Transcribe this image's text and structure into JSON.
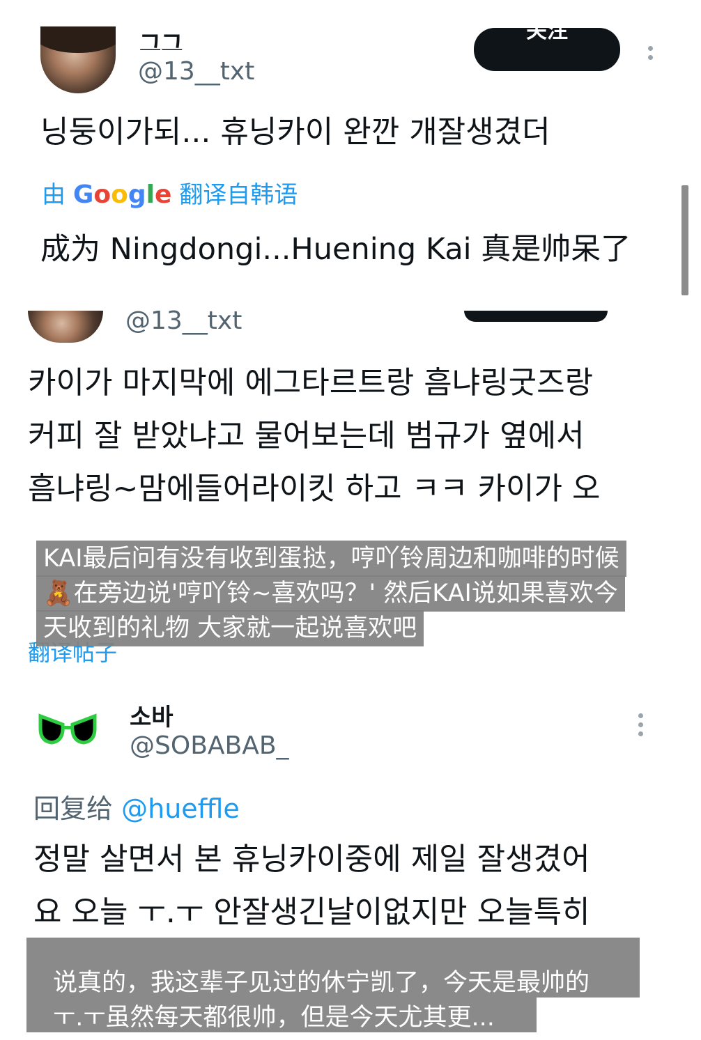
{
  "tweet1": {
    "name_fragment": "그그",
    "handle": "@13__txt",
    "follow_label": "关注",
    "body": "닝둥이가되... 휴닝카이 완깐 개잘생겼더",
    "translated_by_prefix": "由",
    "translated_by_brand": "Google",
    "translated_by_suffix": "翻译自韩语",
    "translation": "成为 Ningdongi...Huening Kai 真是帅呆了"
  },
  "tweet2": {
    "handle": "@13__txt",
    "lines": [
      "카이가 마지막에 에그타르트랑 흠냐링굿즈랑",
      "커피 잘 받았냐고 물어보는데 범규가 옆에서",
      "흠냐링~맘에들어라이킷 하고 ㅋㅋ 카이가 오"
    ],
    "translate_link": "翻译帖子",
    "caption_lines": [
      "KAI最后问有没有收到蛋挞，哼吖铃周边和咖啡的时候",
      "🧸在旁边说'哼吖铃~喜欢吗？' 然后KAI说如果喜欢今",
      "天收到的礼物 大家就一起说喜欢吧"
    ]
  },
  "tweet3": {
    "name": "소바",
    "handle": "@SOBABAB_",
    "reply_prefix": "回复给",
    "reply_to": "@hueffle",
    "lines": [
      "정말 살면서 본 휴닝카이중에 제일 잘생겼어",
      "요 오늘 ㅜ.ㅜ 안잘생긴날이없지만 오늘특히"
    ],
    "caption_lines": [
      "说真的，我这辈子见过的休宁凯了，今天是最帅的",
      "ㅜ.ㅜ虽然每天都很帅，但是今天尤其更..."
    ]
  },
  "colors": {
    "link": "#1d9bf0",
    "text": "#0f1419",
    "secondary": "#536471",
    "caption_bg": "#808080"
  }
}
